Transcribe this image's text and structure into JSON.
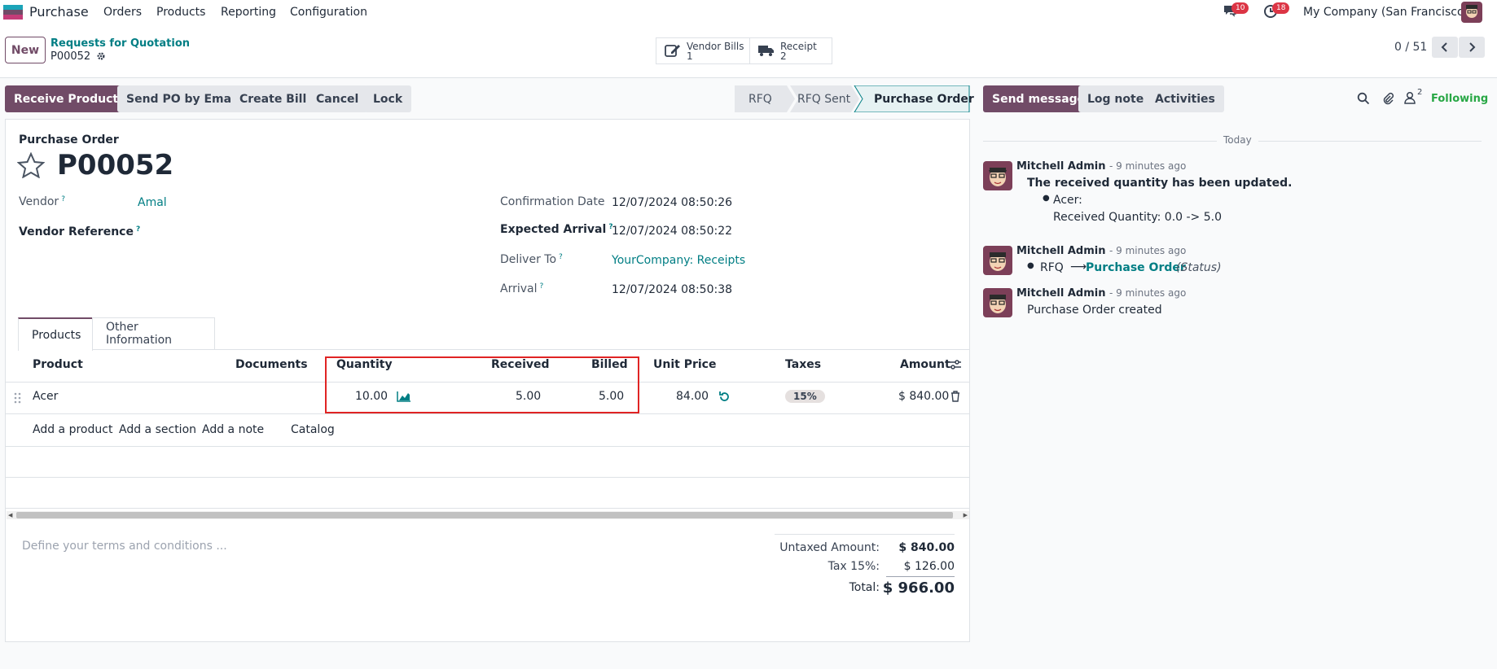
{
  "navbar": {
    "app_name": "Purchase",
    "menus": [
      "Orders",
      "Products",
      "Reporting",
      "Configuration"
    ],
    "messages_count": "10",
    "activities_count": "18",
    "company": "My Company (San Francisco)",
    "accent": "#714b67",
    "teal": "#017e84"
  },
  "control": {
    "new_label": "New",
    "breadcrumb_parent": "Requests for Quotation",
    "breadcrumb_current": "P00052",
    "smart_buttons": [
      {
        "label": "Vendor Bills",
        "count": "1",
        "icon": "pencil-square-icon"
      },
      {
        "label": "Receipt",
        "count": "2",
        "icon": "truck-icon"
      }
    ],
    "pager": "0 / 51"
  },
  "status_buttons": [
    "Receive Products",
    "Send PO by Email",
    "Create Bill",
    "Cancel",
    "Lock"
  ],
  "stages": [
    "RFQ",
    "RFQ Sent",
    "Purchase Order"
  ],
  "form": {
    "type_label": "Purchase Order",
    "name": "P00052",
    "vendor_label": "Vendor",
    "vendor_value": "Amal",
    "vendor_ref_label": "Vendor Reference",
    "confirmation_label": "Confirmation Date",
    "confirmation_value": "12/07/2024 08:50:26",
    "expected_label": "Expected Arrival",
    "expected_value": "12/07/2024 08:50:22",
    "deliver_label": "Deliver To",
    "deliver_value": "YourCompany: Receipts",
    "arrival_label": "Arrival",
    "arrival_value": "12/07/2024 08:50:38",
    "help_mark": "?"
  },
  "tabs": [
    "Products",
    "Other Information"
  ],
  "table": {
    "headers": [
      "Product",
      "Documents",
      "Quantity",
      "Received",
      "Billed",
      "Unit Price",
      "Taxes",
      "Amount"
    ],
    "rows": [
      {
        "product": "Acer",
        "quantity": "10.00",
        "received": "5.00",
        "billed": "5.00",
        "unit_price": "84.00",
        "tax": "15%",
        "amount": "$ 840.00"
      }
    ],
    "actions": [
      "Add a product",
      "Add a section",
      "Add a note",
      "Catalog"
    ]
  },
  "terms_placeholder": "Define your terms and conditions ...",
  "totals": {
    "untaxed_label": "Untaxed Amount:",
    "untaxed_value": "$ 840.00",
    "tax_label": "Tax 15%:",
    "tax_value": "$ 126.00",
    "total_label": "Total:",
    "total_value": "$ 966.00"
  },
  "chatter": {
    "send_message": "Send message",
    "log_note": "Log note",
    "activities": "Activities",
    "followers_count": "2",
    "following": "Following",
    "date_separator": "Today",
    "messages": [
      {
        "author": "Mitchell Admin",
        "ago": "- 9 minutes ago",
        "title": "The received quantity has been updated.",
        "item": "Acer:",
        "detail": "Received Quantity: 0.0 -> 5.0"
      },
      {
        "author": "Mitchell Admin",
        "ago": "- 9 minutes ago",
        "from": "RFQ",
        "arrow": "⟶",
        "to": "Purchase Order",
        "field": "(Status)"
      },
      {
        "author": "Mitchell Admin",
        "ago": "- 9 minutes ago",
        "text": "Purchase Order created"
      }
    ]
  }
}
